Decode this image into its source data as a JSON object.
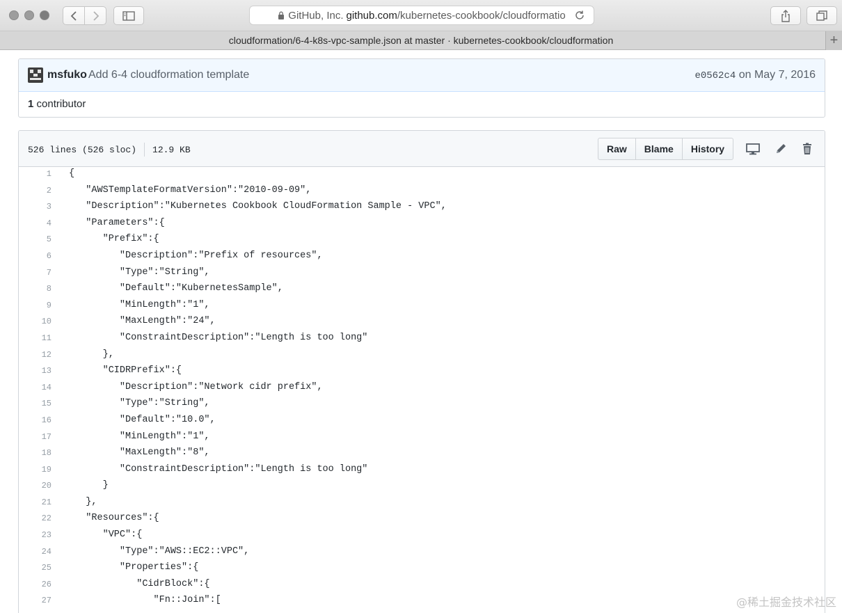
{
  "browser": {
    "address": {
      "org": "GitHub, Inc.",
      "host": "github.com",
      "path": "/kubernetes-cookbook/cloudformatio"
    },
    "tab_title": "cloudformation/6-4-k8s-vpc-sample.json at master · kubernetes-cookbook/cloudformation"
  },
  "commit": {
    "author": "msfuko",
    "message": "Add 6-4 cloudformation template",
    "sha": "e0562c4",
    "date_text": "on May 7, 2016",
    "contributor_count": "1",
    "contributor_label": "contributor"
  },
  "file": {
    "lines_info": "526 lines (526 sloc)",
    "size": "12.9 KB",
    "buttons": {
      "raw": "Raw",
      "blame": "Blame",
      "history": "History"
    },
    "icons": [
      "desktop-icon",
      "pencil-icon",
      "trash-icon"
    ],
    "code_lines": [
      {
        "n": "1",
        "text": "{"
      },
      {
        "n": "2",
        "text": "   \"AWSTemplateFormatVersion\":\"2010-09-09\","
      },
      {
        "n": "3",
        "text": "   \"Description\":\"Kubernetes Cookbook CloudFormation Sample - VPC\","
      },
      {
        "n": "4",
        "text": "   \"Parameters\":{"
      },
      {
        "n": "5",
        "text": "      \"Prefix\":{"
      },
      {
        "n": "6",
        "text": "         \"Description\":\"Prefix of resources\","
      },
      {
        "n": "7",
        "text": "         \"Type\":\"String\","
      },
      {
        "n": "8",
        "text": "         \"Default\":\"KubernetesSample\","
      },
      {
        "n": "9",
        "text": "         \"MinLength\":\"1\","
      },
      {
        "n": "10",
        "text": "         \"MaxLength\":\"24\","
      },
      {
        "n": "11",
        "text": "         \"ConstraintDescription\":\"Length is too long\""
      },
      {
        "n": "12",
        "text": "      },"
      },
      {
        "n": "13",
        "text": "      \"CIDRPrefix\":{"
      },
      {
        "n": "14",
        "text": "         \"Description\":\"Network cidr prefix\","
      },
      {
        "n": "15",
        "text": "         \"Type\":\"String\","
      },
      {
        "n": "16",
        "text": "         \"Default\":\"10.0\","
      },
      {
        "n": "17",
        "text": "         \"MinLength\":\"1\","
      },
      {
        "n": "18",
        "text": "         \"MaxLength\":\"8\","
      },
      {
        "n": "19",
        "text": "         \"ConstraintDescription\":\"Length is too long\""
      },
      {
        "n": "20",
        "text": "      }"
      },
      {
        "n": "21",
        "text": "   },"
      },
      {
        "n": "22",
        "text": "   \"Resources\":{"
      },
      {
        "n": "23",
        "text": "      \"VPC\":{"
      },
      {
        "n": "24",
        "text": "         \"Type\":\"AWS::EC2::VPC\","
      },
      {
        "n": "25",
        "text": "         \"Properties\":{"
      },
      {
        "n": "26",
        "text": "            \"CidrBlock\":{"
      },
      {
        "n": "27",
        "text": "               \"Fn::Join\":["
      }
    ]
  },
  "watermark": "@稀土掘金技术社区",
  "colors": {
    "commit_bg": "#f1f8ff",
    "header_bg": "#f6f8fa",
    "line_number": "#959da5"
  }
}
